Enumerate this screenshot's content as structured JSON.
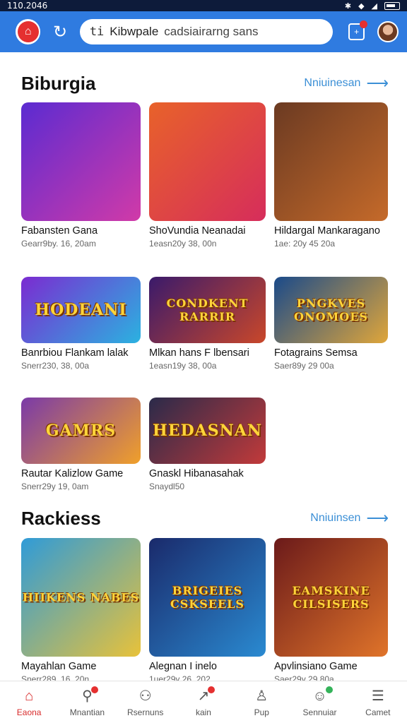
{
  "status_bar": {
    "time": "110.2046"
  },
  "top_bar": {
    "search_prefix": "ti",
    "search_value": "Kibwpale",
    "search_placeholder": "cadsiairarng sans"
  },
  "sections": [
    {
      "title": "Biburgia",
      "see_more": "Nniuinesan",
      "games": [
        {
          "title": "Fabansten Gana",
          "meta": "Gearr9by. 16, 20am",
          "art": "",
          "colors": [
            "#5b2bd1",
            "#d13aa8"
          ]
        },
        {
          "title": "ShoVundia Neanadai",
          "meta": "1easn20y 38, 00n",
          "art": "",
          "colors": [
            "#e8622a",
            "#d62d5b"
          ]
        },
        {
          "title": "Hildargal Mankaragano",
          "meta": "1ae: 20y 45 20a",
          "art": "",
          "colors": [
            "#6b3a22",
            "#c56a2a"
          ]
        },
        {
          "title": "Banrbiou Flankam lalak",
          "meta": "Snerr230, 38, 00a",
          "art": "HODEANI",
          "colors": [
            "#7b2bd1",
            "#2bb2e0"
          ]
        },
        {
          "title": "Mlkan hans F lbensari",
          "meta": "1easn19y 38, 00a",
          "art": "CONDKENT RARRIR",
          "colors": [
            "#3a1a6b",
            "#c9472a"
          ]
        },
        {
          "title": "Fotagrains Semsa",
          "meta": "Saer89y 29 00a",
          "art": "PNGKVES ONOMOES",
          "colors": [
            "#1a4a8a",
            "#e0a63a"
          ]
        },
        {
          "title": "Rautar Kalizlow Game",
          "meta": "Snerr29y 19, 0am",
          "art": "GAMRS",
          "colors": [
            "#7a3aa8",
            "#f0a02a"
          ]
        },
        {
          "title": "Gnaskl Hibanasahak",
          "meta": "Snaydl50",
          "art": "HEDASNAN",
          "colors": [
            "#2a2a4a",
            "#c23a3a"
          ]
        }
      ]
    },
    {
      "title": "Rackiess",
      "see_more": "Nniuinsen",
      "games": [
        {
          "title": "Mayahlan Game",
          "meta": "Snerr289, 16, 20n",
          "art": "HIIKENS NABES",
          "colors": [
            "#2f9bd8",
            "#e8c23a"
          ]
        },
        {
          "title": "Alegnan I inelo",
          "meta": "1uer29y 26, 202",
          "art": "BRIGEIES CSKSEELS",
          "colors": [
            "#1a2a6b",
            "#2a8ad1"
          ]
        },
        {
          "title": "Apvlinsiano Game",
          "meta": "Saer29y 29 80a",
          "art": "EAMSKINE CILSISERS",
          "colors": [
            "#6b1a1a",
            "#e0742a"
          ]
        }
      ]
    }
  ],
  "bottom_nav": [
    {
      "label": "Eaona",
      "icon": "home-icon",
      "glyph": "⌂",
      "active": true
    },
    {
      "label": "Mnantian",
      "icon": "search-icon",
      "glyph": "⚲"
    },
    {
      "label": "Rsernuns",
      "icon": "people-icon",
      "glyph": "⚇"
    },
    {
      "label": "kain",
      "icon": "chart-icon",
      "glyph": "↗"
    },
    {
      "label": "Pup",
      "icon": "user-icon",
      "glyph": "♙"
    },
    {
      "label": "Sennuiar",
      "icon": "message-icon",
      "glyph": "☺"
    },
    {
      "label": "Camet",
      "icon": "menu-icon",
      "glyph": "☰"
    }
  ],
  "colors": {
    "primary": "#2f7be0",
    "accent": "#e53030",
    "link": "#3b8fd6"
  }
}
